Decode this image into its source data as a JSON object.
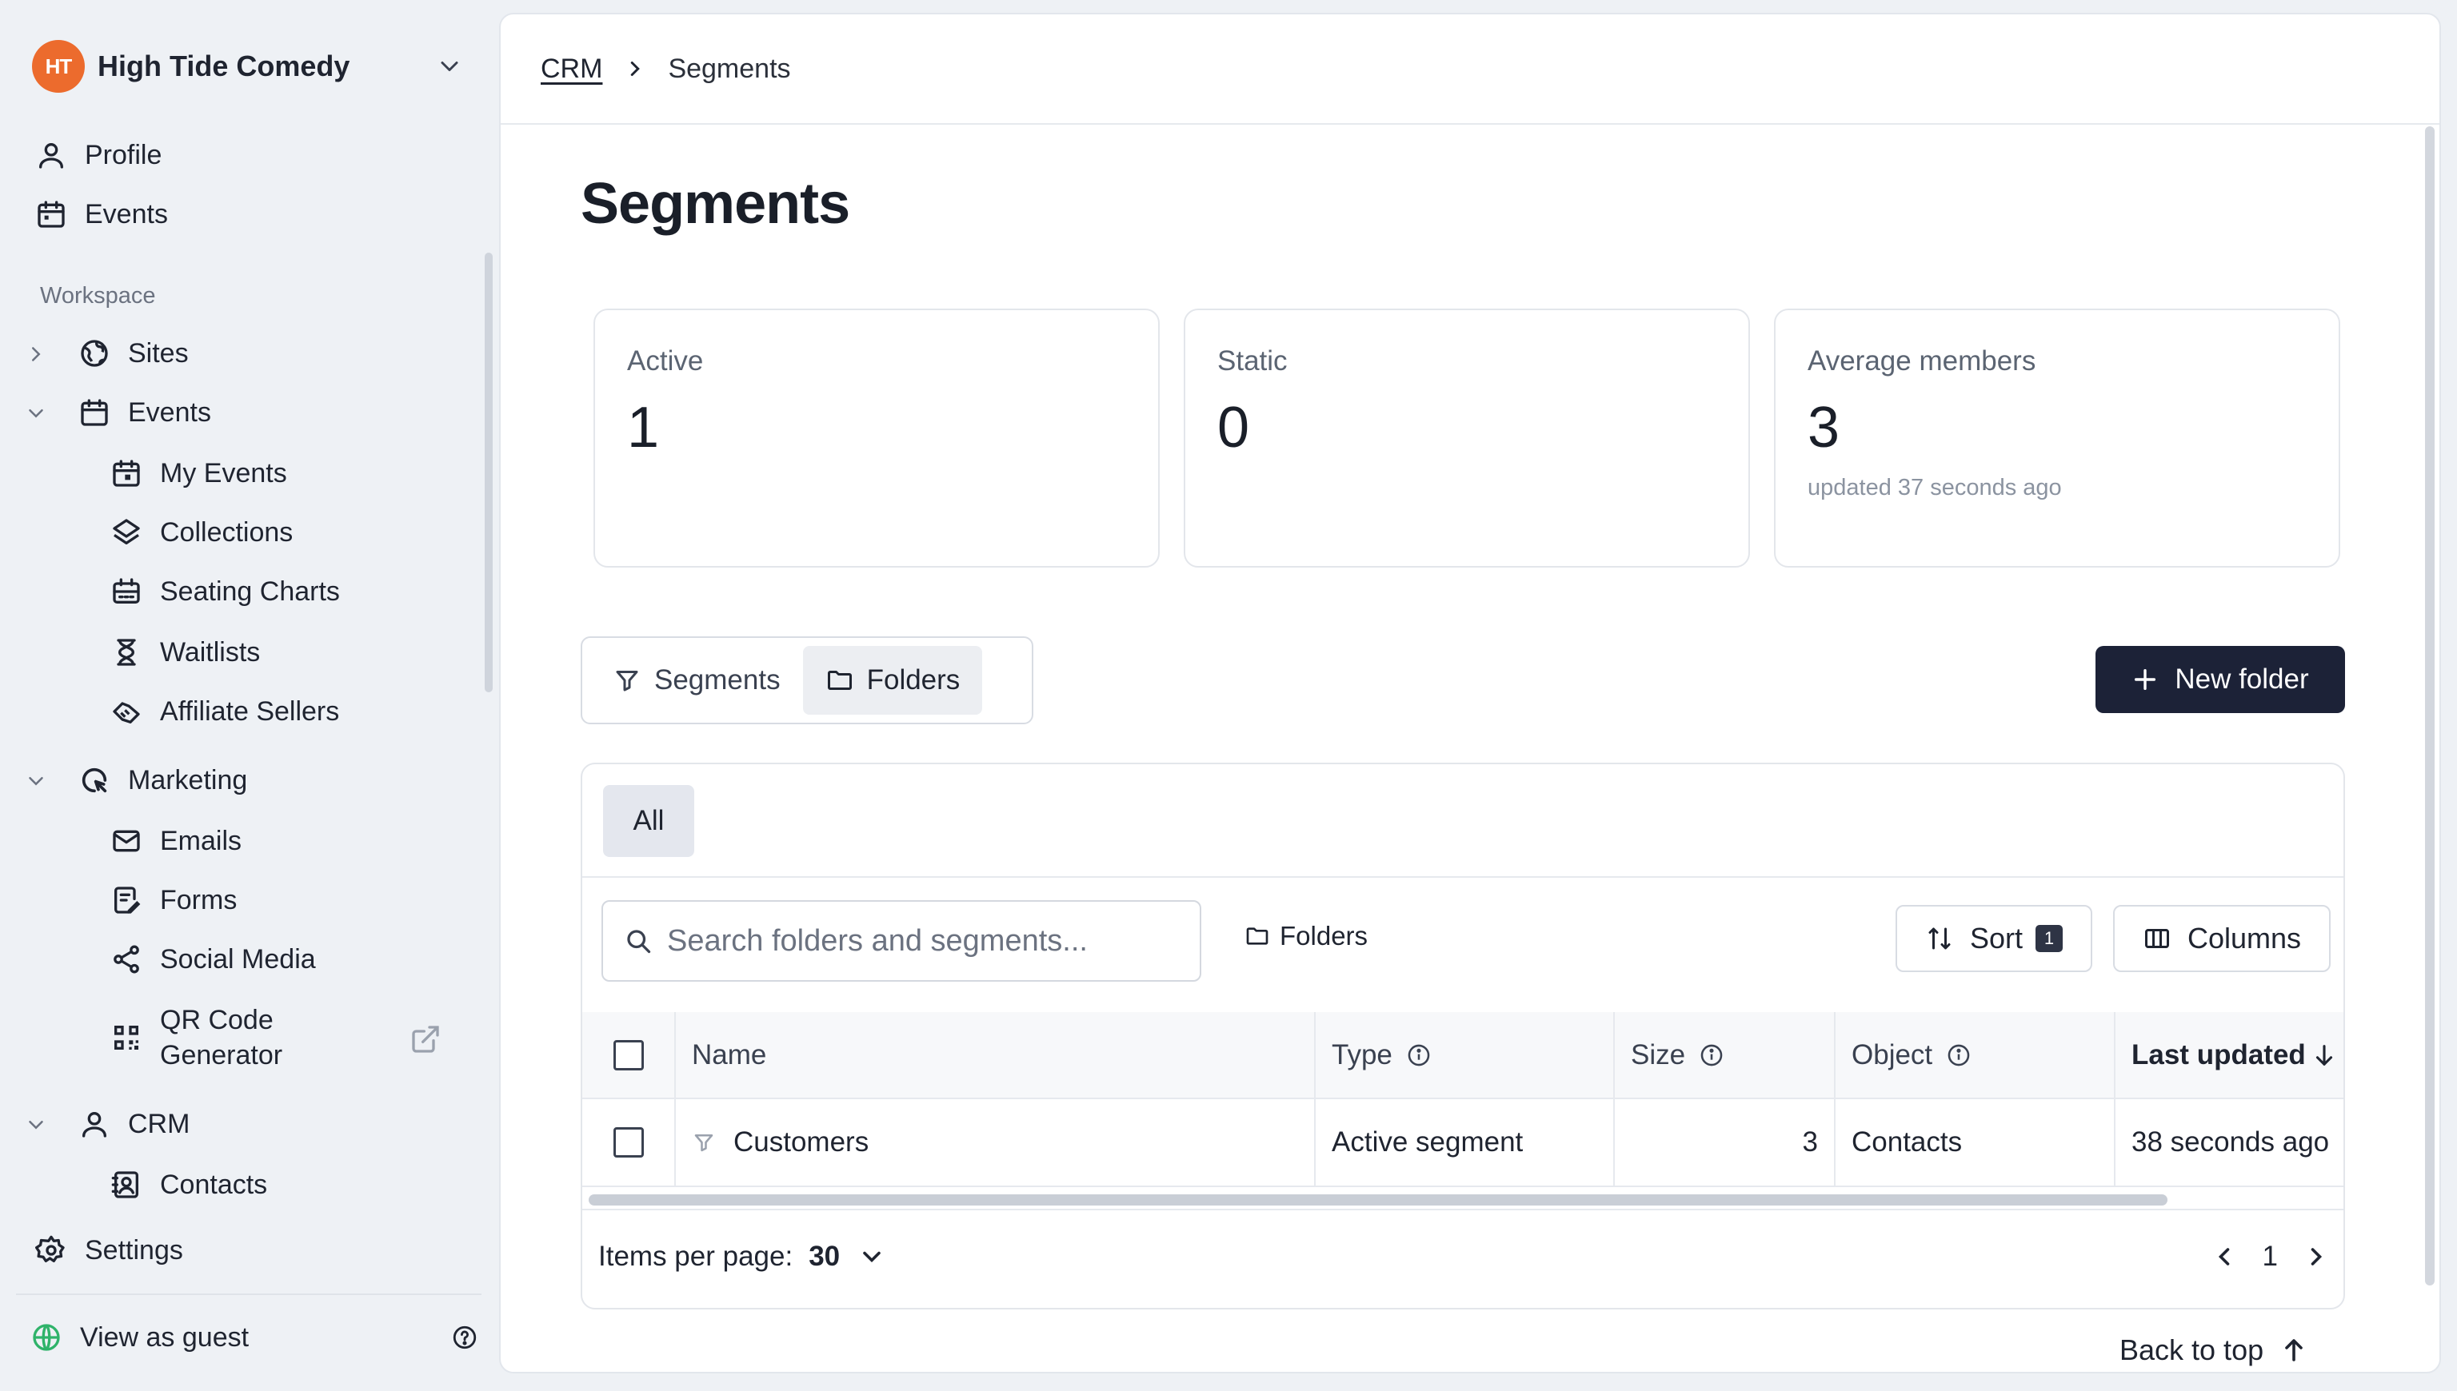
{
  "org": {
    "name": "High Tide Comedy",
    "logo_text": "HT"
  },
  "sidebar": {
    "top_items": [
      {
        "label": "Profile",
        "icon": "user-icon"
      },
      {
        "label": "Events",
        "icon": "calendar-icon"
      }
    ],
    "section_label": "Workspace",
    "groups": {
      "sites": {
        "label": "Sites",
        "icon": "globe-icon"
      },
      "events": {
        "label": "Events",
        "icon": "calendar-icon",
        "children": [
          {
            "label": "My Events",
            "icon": "calendar-star-icon"
          },
          {
            "label": "Collections",
            "icon": "layers-icon"
          },
          {
            "label": "Seating Charts",
            "icon": "seating-icon"
          },
          {
            "label": "Waitlists",
            "icon": "hourglass-icon"
          },
          {
            "label": "Affiliate Sellers",
            "icon": "handshake-icon"
          }
        ]
      },
      "marketing": {
        "label": "Marketing",
        "icon": "megaphone-icon",
        "children": [
          {
            "label": "Emails",
            "icon": "mail-icon"
          },
          {
            "label": "Forms",
            "icon": "form-icon"
          },
          {
            "label": "Social Media",
            "icon": "share-icon"
          },
          {
            "label": "QR Code Generator",
            "line1": "QR Code",
            "line2": "Generator",
            "icon": "qr-code-icon"
          }
        ]
      },
      "crm": {
        "label": "CRM",
        "icon": "user-icon",
        "children": [
          {
            "label": "Contacts",
            "icon": "contacts-icon"
          }
        ]
      }
    },
    "settings": {
      "label": "Settings",
      "icon": "gear-icon"
    },
    "guest": {
      "label": "View as guest",
      "icon": "eye-globe-icon"
    }
  },
  "breadcrumb": {
    "parent": "CRM",
    "current": "Segments"
  },
  "page": {
    "title": "Segments"
  },
  "stats": [
    {
      "label": "Active",
      "value": "1",
      "sub": ""
    },
    {
      "label": "Static",
      "value": "0",
      "sub": ""
    },
    {
      "label": "Average members",
      "value": "3",
      "sub": "updated 37 seconds ago"
    }
  ],
  "view_toggle": {
    "segments_label": "Segments",
    "folders_label": "Folders",
    "selected": "Folders"
  },
  "new_folder_label": "New folder",
  "table_tabs": [
    {
      "label": "All",
      "selected": true
    }
  ],
  "search": {
    "placeholder": "Search folders and segments...",
    "value": ""
  },
  "folders_filter_label": "Folders",
  "sort": {
    "label": "Sort",
    "count": "1"
  },
  "columns_label": "Columns",
  "table": {
    "columns": [
      {
        "key": "name",
        "label": "Name"
      },
      {
        "key": "type",
        "label": "Type"
      },
      {
        "key": "size",
        "label": "Size"
      },
      {
        "key": "object",
        "label": "Object"
      },
      {
        "key": "updated",
        "label": "Last updated"
      }
    ],
    "rows": [
      {
        "name": "Customers",
        "type": "Active segment",
        "size": "3",
        "object": "Contacts",
        "updated": "38 seconds ago"
      }
    ]
  },
  "pagination": {
    "per_page_label": "Items per page:",
    "per_page_value": "30",
    "page": "1"
  },
  "back_to_top_label": "Back to top",
  "colors": {
    "brand": "#ec6b2d",
    "primary_button": "#1c2237",
    "sidebar_bg": "#eef1f5"
  }
}
